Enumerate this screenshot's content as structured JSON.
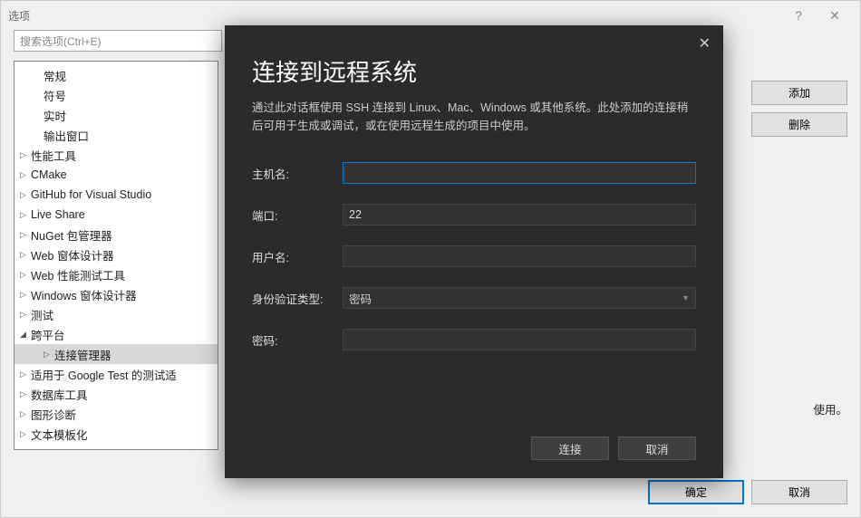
{
  "options": {
    "title": "选项",
    "searchPlaceholder": "搜索选项(Ctrl+E)",
    "tree": {
      "general": "常规",
      "symbols": "符号",
      "realtime": "实时",
      "outputWindow": "输出窗口",
      "perfTools": "性能工具",
      "cmake": "CMake",
      "github": "GitHub for Visual Studio",
      "liveShare": "Live Share",
      "nuget": "NuGet 包管理器",
      "webForms": "Web 窗体设计器",
      "webPerf": "Web 性能测试工具",
      "winForms": "Windows 窗体设计器",
      "test": "测试",
      "crossPlatform": "跨平台",
      "connectionManager": "连接管理器",
      "googleTest": "适用于 Google Test 的测试适",
      "dbTools": "数据库工具",
      "graphics": "图形诊断",
      "textTemplate": "文本模板化"
    },
    "addButton": "添加",
    "deleteButton": "删除",
    "rightText": "使用。",
    "ok": "确定",
    "cancel": "取消"
  },
  "modal": {
    "title": "连接到远程系统",
    "description": "通过此对话框使用 SSH 连接到 Linux、Mac、Windows 或其他系统。此处添加的连接稍后可用于生成或调试，或在使用远程生成的项目中使用。",
    "hostLabel": "主机名:",
    "hostValue": "",
    "portLabel": "端口:",
    "portValue": "22",
    "userLabel": "用户名:",
    "userValue": "",
    "authLabel": "身份验证类型:",
    "authValue": "密码",
    "passwordLabel": "密码:",
    "passwordValue": "",
    "connect": "连接",
    "cancel": "取消"
  }
}
